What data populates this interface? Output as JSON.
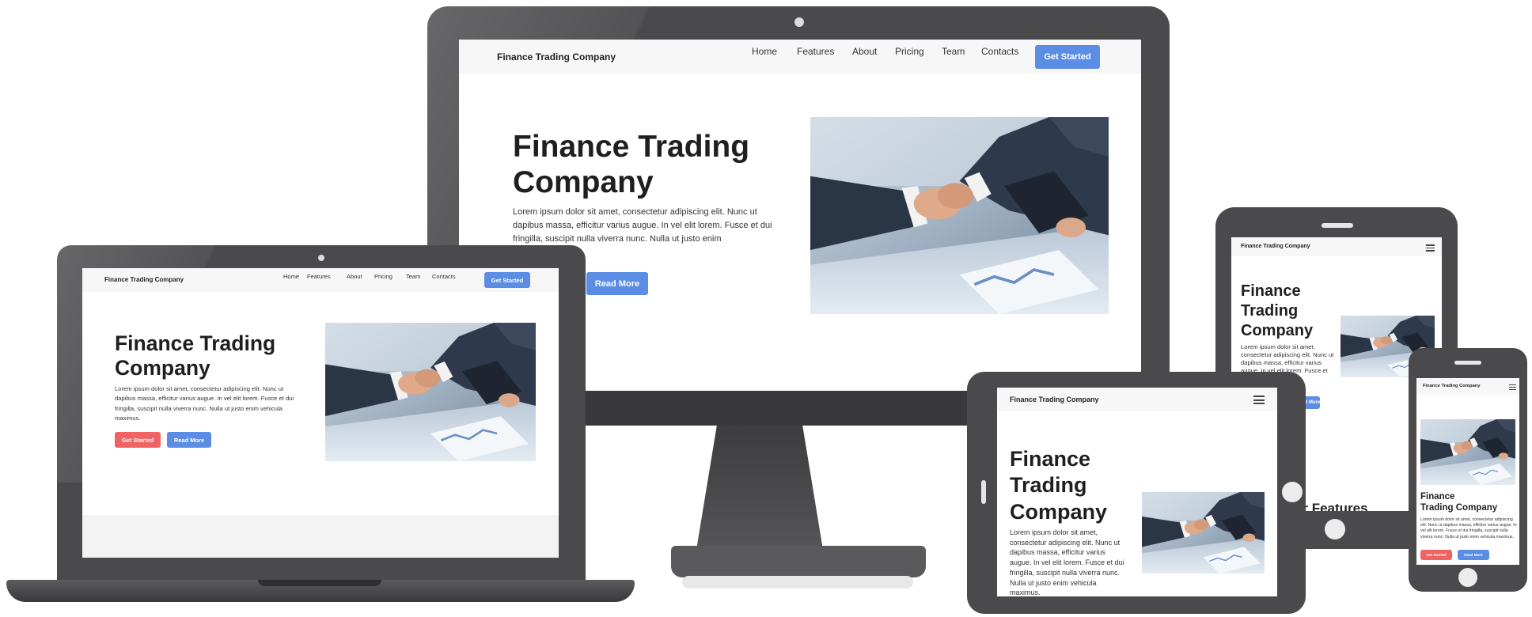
{
  "site": {
    "brand": "Finance Trading Company",
    "nav_links": [
      "Home",
      "Features",
      "About",
      "Pricing",
      "Team",
      "Contacts"
    ],
    "cta_label": "Get Started",
    "hero_title": "Finance Trading Company",
    "hero_title_line1": "Finance Trading",
    "hero_title_line2": "Company",
    "hero_title_stack": [
      "Finance",
      "Trading",
      "Company"
    ],
    "hero_text": "Lorem ipsum dolor sit amet, consectetur adipiscing elit. Nunc ut dapibus massa, efficitur varius augue. In vel elit lorem. Fusce et dui fringilla, suscipit nulla viverra nunc. Nulla ut justo enim",
    "hero_text_full": "Lorem ipsum dolor sit amet, consectetur adipiscing elit. Nunc ut dapibus massa, efficitur varius augue. In vel elit lorem. Fusce et dui fringilla, suscipit nulla viverra nunc. Nulla ut justo enim vehicula maximus.",
    "read_more_label": "Read More",
    "features_heading_partial": "ur Features"
  },
  "colors": {
    "primary": "#5b8de4",
    "accent_red": "#ef6363",
    "device_frame": "#4a4a4c",
    "device_frame_dark": "#333335",
    "nav_bg": "#f7f7f7"
  },
  "icons": {
    "menu": "hamburger-icon",
    "camera": "camera-icon",
    "home_button": "home-button-icon"
  }
}
